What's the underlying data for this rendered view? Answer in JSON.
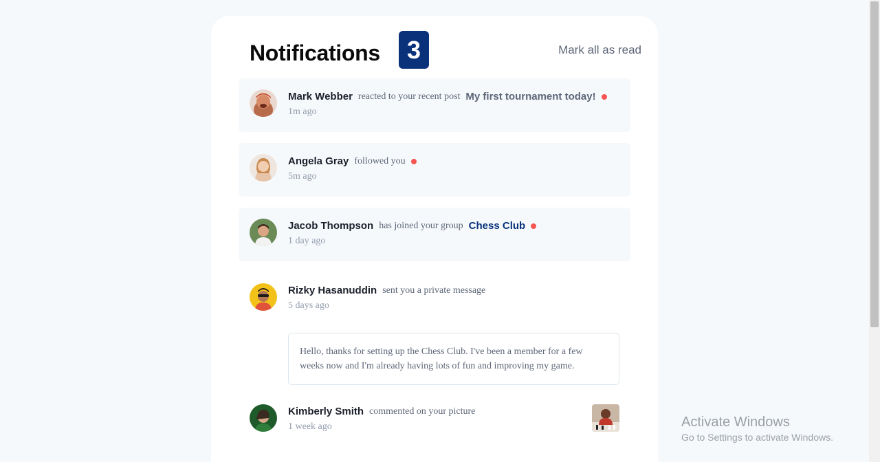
{
  "header": {
    "title": "Notifications",
    "unread_count": "3",
    "mark_all_label": "Mark all as read"
  },
  "notifications": [
    {
      "name": "Mark Webber",
      "action": "reacted to your recent post",
      "target": "My first tournament today!",
      "time": "1m ago",
      "unread": true,
      "avatar_icon": "avatar-mark-webber"
    },
    {
      "name": "Angela Gray",
      "action": "followed you",
      "time": "5m ago",
      "unread": true,
      "avatar_icon": "avatar-angela-gray"
    },
    {
      "name": "Jacob Thompson",
      "action": "has joined your group",
      "target": "Chess Club",
      "time": "1 day ago",
      "unread": true,
      "avatar_icon": "avatar-jacob-thompson"
    },
    {
      "name": "Rizky Hasanuddin",
      "action": "sent you a private message",
      "time": "5 days ago",
      "unread": false,
      "message": "Hello, thanks for setting up the Chess Club. I've been a member for a few weeks now and I'm already having lots of fun and improving my game.",
      "avatar_icon": "avatar-rizky-hasanuddin"
    },
    {
      "name": "Kimberly Smith",
      "action": "commented on your picture",
      "time": "1 week ago",
      "unread": false,
      "avatar_icon": "avatar-kimberly-smith",
      "picture_icon": "chess-picture-thumbnail"
    }
  ],
  "watermark": {
    "title": "Activate Windows",
    "subtitle": "Go to Settings to activate Windows."
  },
  "colors": {
    "badge": "#0a327b",
    "unread_dot": "#f65552",
    "unread_bg": "#f6f9fc",
    "group_link": "#0a327b"
  }
}
